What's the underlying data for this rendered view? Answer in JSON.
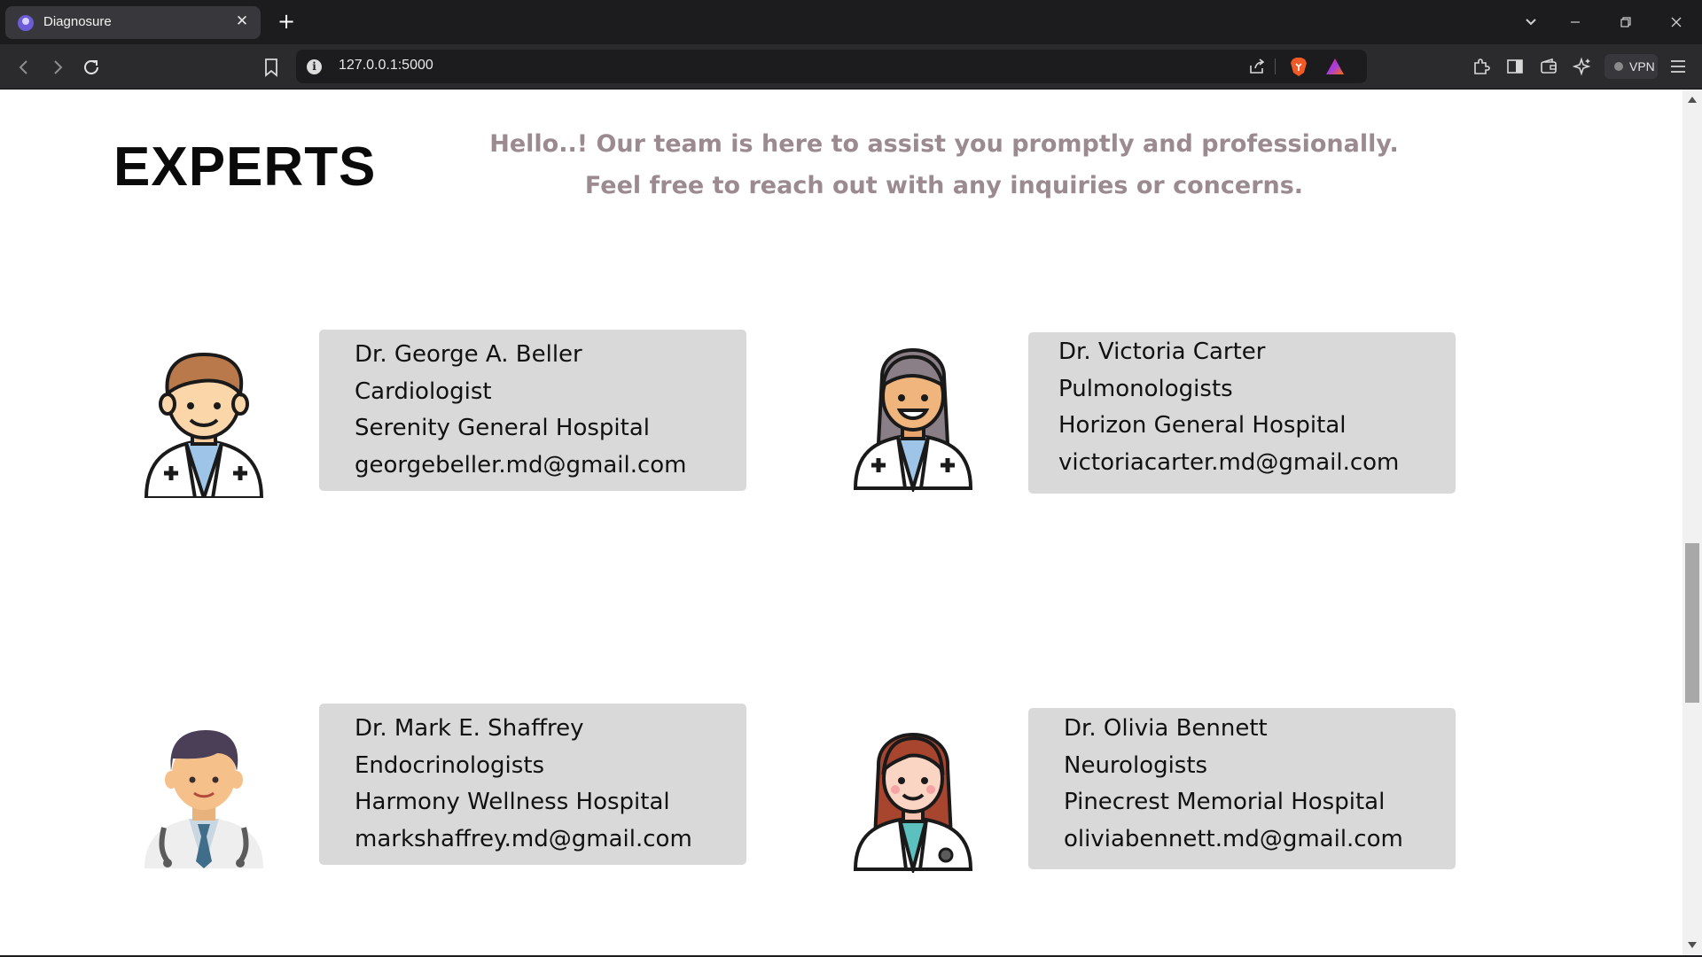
{
  "browser": {
    "tab_title": "Diagnosure",
    "url": "127.0.0.1:5000",
    "vpn_label": "VPN"
  },
  "page": {
    "heading": "EXPERTS",
    "intro": "Hello..! Our team is here to assist you promptly and professionally. Feel free to reach out with any inquiries or concerns."
  },
  "doctors": [
    {
      "name": "Dr. George A. Beller",
      "specialty": "Cardiologist",
      "hospital": "Serenity General Hospital",
      "email": "georgebeller.md@gmail.com",
      "avatar": "male-doctor-brown-hair-icon"
    },
    {
      "name": "Dr. Victoria Carter",
      "specialty": "Pulmonologists",
      "hospital": "Horizon General Hospital",
      "email": "victoriacarter.md@gmail.com",
      "avatar": "female-doctor-gray-hair-icon"
    },
    {
      "name": "Dr. Mark E. Shaffrey",
      "specialty": "Endocrinologists",
      "hospital": "Harmony Wellness Hospital",
      "email": "markshaffrey.md@gmail.com",
      "avatar": "male-doctor-stethoscope-icon"
    },
    {
      "name": "Dr. Olivia Bennett",
      "specialty": "Neurologists",
      "hospital": "Pinecrest Memorial Hospital",
      "email": "oliviabennett.md@gmail.com",
      "avatar": "female-doctor-red-hair-icon"
    }
  ],
  "colors": {
    "intro_text": "#9b8a8f",
    "card_background": "#d9d9d9",
    "chrome_dark": "#1c1c1f"
  }
}
